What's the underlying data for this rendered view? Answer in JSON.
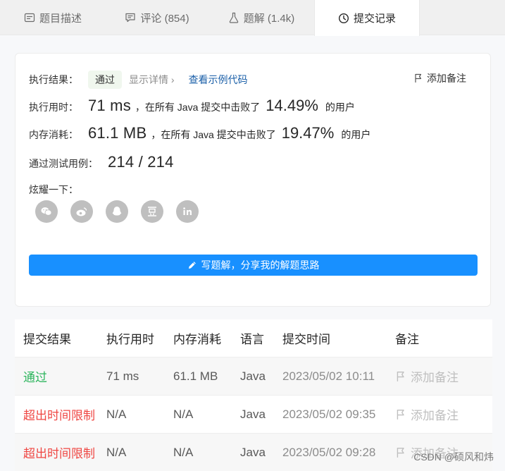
{
  "tabs": [
    {
      "label": "题目描述",
      "icon": "description-icon"
    },
    {
      "label": "评论 (854)",
      "icon": "comment-icon"
    },
    {
      "label": "题解 (1.4k)",
      "icon": "flask-icon"
    },
    {
      "label": "提交记录",
      "icon": "clock-icon"
    }
  ],
  "result": {
    "status_label": "执行结果：",
    "status": "通过",
    "detail_link": "显示详情 ›",
    "example_link": "查看示例代码",
    "add_note": "添加备注",
    "runtime_label": "执行用时：",
    "runtime_value": "71 ms",
    "runtime_mid": "，在所有 Java 提交中击败了",
    "runtime_pct": "14.49%",
    "runtime_tail": "的用户",
    "memory_label": "内存消耗：",
    "memory_value": "61.1 MB",
    "memory_mid": "，在所有 Java 提交中击败了",
    "memory_pct": "19.47%",
    "memory_tail": "的用户",
    "tests_label": "通过测试用例：",
    "tests_value": "214 / 214",
    "share_label": "炫耀一下：",
    "write_solution": "写题解，分享我的解题思路"
  },
  "table": {
    "headers": [
      "提交结果",
      "执行用时",
      "内存消耗",
      "语言",
      "提交时间",
      "备注"
    ],
    "rows": [
      {
        "status": "通过",
        "runtime": "71 ms",
        "memory": "61.1 MB",
        "lang": "Java",
        "time": "2023/05/02 10:11",
        "note": "添加备注"
      },
      {
        "status": "超出时间限制",
        "runtime": "N/A",
        "memory": "N/A",
        "lang": "Java",
        "time": "2023/05/02 09:35",
        "note": "添加备注"
      },
      {
        "status": "超出时间限制",
        "runtime": "N/A",
        "memory": "N/A",
        "lang": "Java",
        "time": "2023/05/02 09:28",
        "note": "添加备注"
      }
    ]
  },
  "watermark": "CSDN @硕风和炜",
  "colors": {
    "accent": "#1890ff",
    "pass": "#2db55d",
    "fail": "#ef4743"
  }
}
